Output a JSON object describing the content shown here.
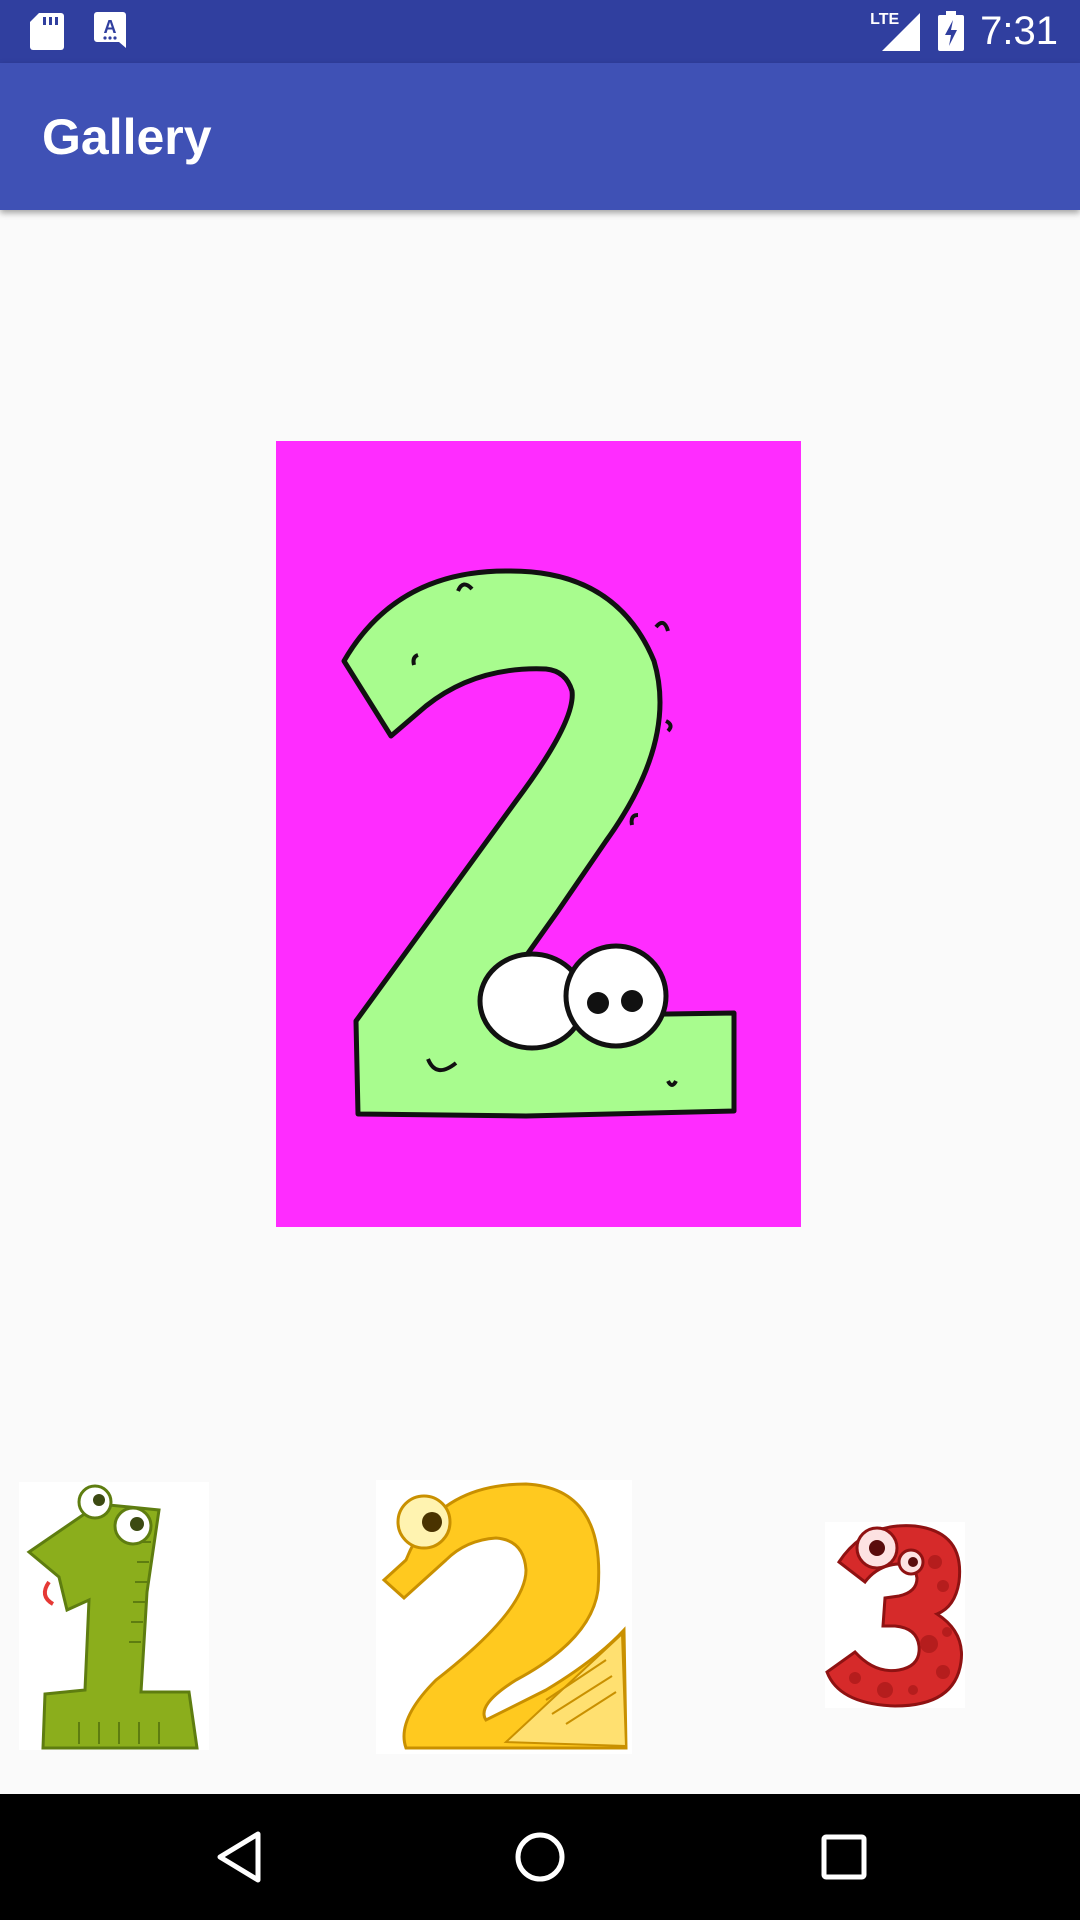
{
  "status_bar": {
    "time": "7:31",
    "network": "LTE",
    "icons": [
      "sd-card-icon",
      "text-format-icon",
      "lte-signal-icon",
      "battery-charging-icon"
    ]
  },
  "app_bar": {
    "title": "Gallery",
    "color": "#3f51b5",
    "status_color": "#303f9f"
  },
  "main_image": {
    "subject": "green-cartoon-number-2",
    "background_color": "#ff2cff"
  },
  "thumbnails": [
    {
      "subject": "green-cartoon-number-1"
    },
    {
      "subject": "yellow-cartoon-number-2"
    },
    {
      "subject": "red-cartoon-number-3"
    }
  ],
  "nav_bar": {
    "buttons": [
      "back-icon",
      "home-icon",
      "recents-icon"
    ]
  }
}
